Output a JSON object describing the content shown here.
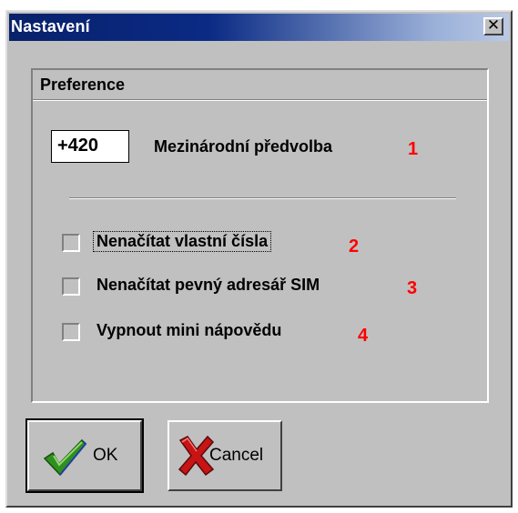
{
  "window": {
    "title": "Nastavení",
    "close_glyph": "✕"
  },
  "group": {
    "title": "Preference"
  },
  "prefix": {
    "value": "+420",
    "label": "Mezinárodní předvolba",
    "marker": "1"
  },
  "options": [
    {
      "label": "Nenačítat vlastní čísla",
      "checked": false,
      "focused": true,
      "marker": "2"
    },
    {
      "label": "Nenačítat pevný adresář SIM",
      "checked": false,
      "focused": false,
      "marker": "3"
    },
    {
      "label": "Vypnout mini nápovědu",
      "checked": false,
      "focused": false,
      "marker": "4"
    }
  ],
  "buttons": {
    "ok_label": "OK",
    "ok_icon": "checkmark-icon",
    "cancel_label": "Cancel",
    "cancel_icon": "red-x-icon"
  },
  "colors": {
    "title_bar_start": "#08216b",
    "title_bar_end": "#b9c9e6",
    "face": "#c0c0c0",
    "marker": "#ff0000",
    "ok_check": "#2f8f1f",
    "cancel_x": "#c81414"
  }
}
